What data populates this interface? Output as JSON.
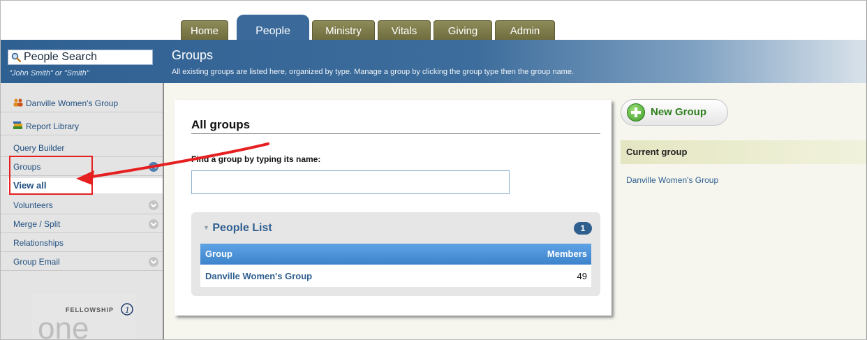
{
  "tabs": [
    "Home",
    "People",
    "Ministry",
    "Vitals",
    "Giving",
    "Admin"
  ],
  "active_tab": "People",
  "search": {
    "value": "People Search",
    "hint": "\"John Smith\" or \"Smith\""
  },
  "page": {
    "title": "Groups",
    "description": "All existing groups are listed here, organized by type. Manage a group by clicking the group type then the group name."
  },
  "sidebar": {
    "items": [
      {
        "label": "Danville Women's Group",
        "icon": "group-icon"
      },
      {
        "label": "Report Library",
        "icon": "books-icon"
      },
      {
        "label": "Query Builder"
      },
      {
        "label": "Groups",
        "expanded": true
      },
      {
        "label": "View all",
        "selected": true
      },
      {
        "label": "Volunteers"
      },
      {
        "label": "Merge / Split"
      },
      {
        "label": "Relationships"
      },
      {
        "label": "Group Email"
      }
    ],
    "logo_text": "FELLOWSHIP",
    "logo_word": "one"
  },
  "main": {
    "title": "All groups",
    "find_label": "Find a group by typing its name:",
    "find_value": "",
    "people_list": {
      "title": "People List",
      "count": "1",
      "columns": [
        "Group",
        "Members"
      ],
      "rows": [
        {
          "group": "Danville Women's Group",
          "members": "49"
        }
      ]
    }
  },
  "right": {
    "new_group_label": "New Group",
    "current_group_header": "Current group",
    "current_group_link": "Danville Women's Group"
  },
  "colors": {
    "header_blue": "#2f6092",
    "tab_olive": "#7d7b4a",
    "annotation_red": "#e62020",
    "link_blue": "#2f5f8f",
    "new_group_green": "#3d9a26"
  }
}
